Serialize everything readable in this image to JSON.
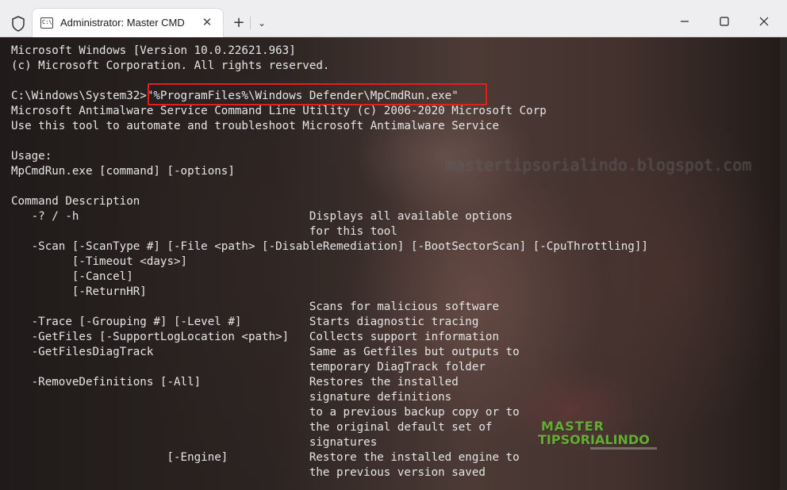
{
  "window": {
    "tab_title": "Administrator: Master CMD",
    "tab_icon_text": "C:\\",
    "tab_close": "✕",
    "new_tab": "+",
    "dropdown": "⌄",
    "minimize": "─",
    "maximize": "☐",
    "close": "✕",
    "icons": {
      "shield": "shield-icon",
      "tab": "terminal-icon"
    }
  },
  "terminal": {
    "lines": [
      "Microsoft Windows [Version 10.0.22621.963]",
      "(c) Microsoft Corporation. All rights reserved.",
      "",
      "C:\\Windows\\System32>\"%ProgramFiles%\\Windows Defender\\MpCmdRun.exe\"",
      "Microsoft Antimalware Service Command Line Utility (c) 2006-2020 Microsoft Corp",
      "Use this tool to automate and troubleshoot Microsoft Antimalware Service",
      "",
      "Usage:",
      "MpCmdRun.exe [command] [-options]",
      "",
      "Command Description",
      "   -? / -h                                  Displays all available options",
      "                                            for this tool",
      "   -Scan [-ScanType #] [-File <path> [-DisableRemediation] [-BootSectorScan] [-CpuThrottling]]",
      "         [-Timeout <days>]",
      "         [-Cancel]",
      "         [-ReturnHR]",
      "                                            Scans for malicious software",
      "   -Trace [-Grouping #] [-Level #]          Starts diagnostic tracing",
      "   -GetFiles [-SupportLogLocation <path>]   Collects support information",
      "   -GetFilesDiagTrack                       Same as Getfiles but outputs to",
      "                                            temporary DiagTrack folder",
      "   -RemoveDefinitions [-All]                Restores the installed",
      "                                            signature definitions",
      "                                            to a previous backup copy or to",
      "                                            the original default set of",
      "                                            signatures",
      "                       [-Engine]            Restore the installed engine to",
      "                                            the previous version saved"
    ],
    "colors": {
      "text": "#e6e6e6",
      "highlight": "#e0201e"
    }
  },
  "watermark": {
    "url": "mastertipsorialindo.blogspot.com",
    "logo_top": "MASTER",
    "logo_bottom": "TIPSORIALINDO"
  }
}
